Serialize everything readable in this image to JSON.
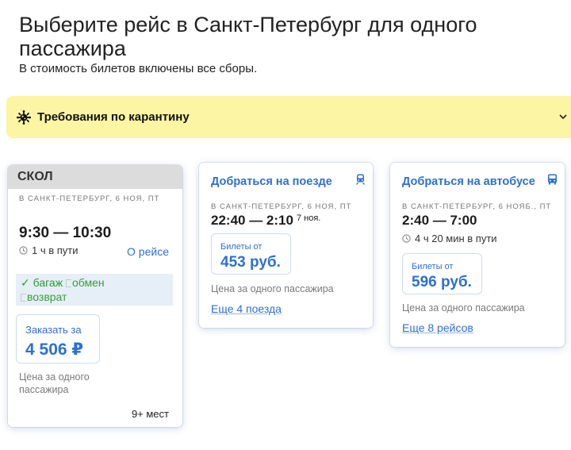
{
  "page": {
    "title": "Выберите рейс в Санкт-Петербург для одного пассажира",
    "subtitle": "В стоимость билетов включены все сборы."
  },
  "quarantine": {
    "label": "Требования по карантину",
    "icon": "virus-icon",
    "chevron": "chevron-down-icon"
  },
  "flight": {
    "airline": "СКОЛ",
    "meta": "в Санкт-Петербург, 6 ноя, пт",
    "times": "9:30 — 10:30",
    "duration": "1 ч в пути",
    "details_link": "О рейсе",
    "options": {
      "baggage": "✓ багаж",
      "exchange": "обмен",
      "refund": "возврат"
    },
    "price_label": "Заказать за",
    "price": "4 506 ₽",
    "price_note": "Цена за одного пассажира",
    "seats": "9+ мест"
  },
  "train": {
    "title": "Добраться на поезде",
    "icon": "train-icon",
    "meta": "в Санкт-Петербург, 6 ноя, пт",
    "times": "22:40 — 2:10",
    "next_day": "7 ноя.",
    "price_label": "Билеты от",
    "price": "453 руб.",
    "price_note": "Цена за одного пассажира",
    "more": "Еще 4 поезда"
  },
  "bus": {
    "title": "Добраться на автобусе",
    "icon": "bus-icon",
    "meta": "в Санкт-Петербург, 6 нояб., пт",
    "times": "2:40 — 7:00",
    "duration": "4 ч 20 мин в пути",
    "price_label": "Билеты от",
    "price": "596 руб.",
    "price_note": "Цена за одного пассажира",
    "more": "Еще 8 рейсов"
  },
  "colors": {
    "accent": "#2e6fd1",
    "banner": "#fbf5a4",
    "included": "#2f9a2f"
  }
}
